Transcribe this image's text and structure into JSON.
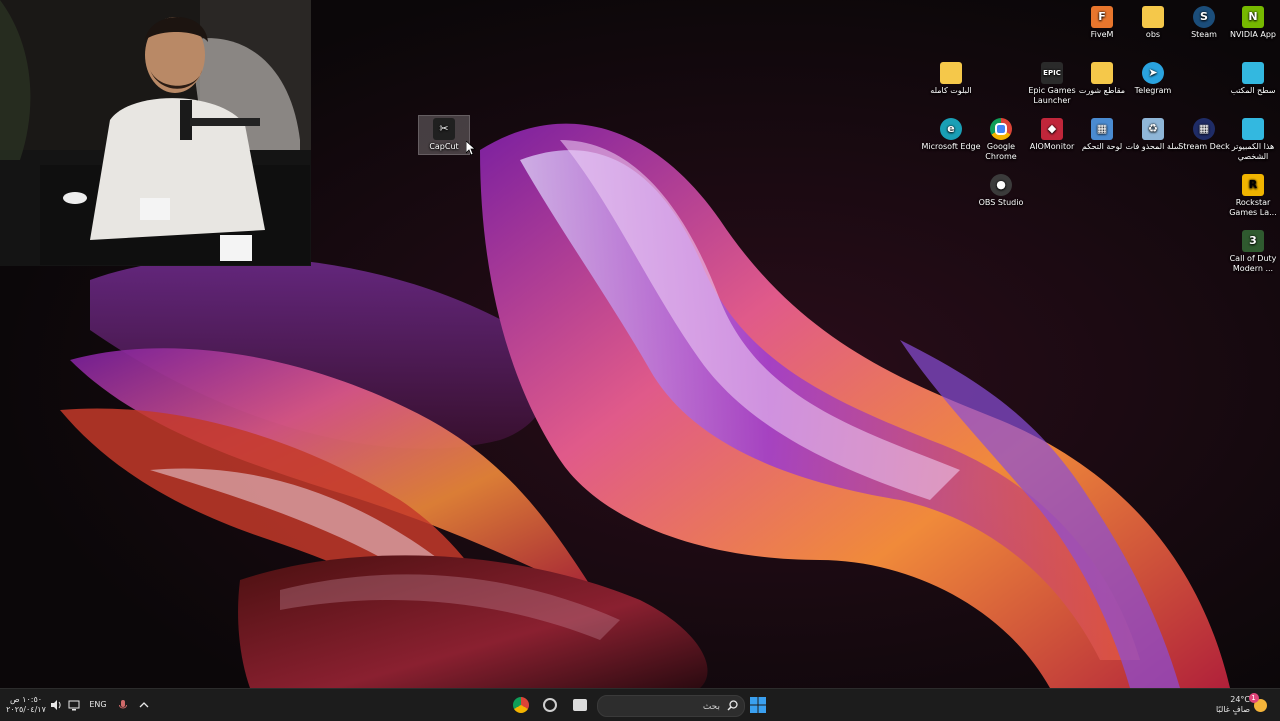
{
  "desktop": {
    "icons": [
      {
        "label": "FiveM",
        "icon": "fivem-icon",
        "color": "#e8762d"
      },
      {
        "label": "obs",
        "icon": "folder-icon",
        "color": "#f5c84a"
      },
      {
        "label": "Steam",
        "icon": "steam-icon",
        "color": "#1b4d7a"
      },
      {
        "label": "NVIDIA App",
        "icon": "nvidia-icon",
        "color": "#76b900"
      },
      {
        "label": "البلوت كامله",
        "icon": "folder-icon",
        "color": "#f5c84a"
      },
      {
        "label": "Epic Games Launcher",
        "icon": "epic-games-icon",
        "color": "#2a2a2a"
      },
      {
        "label": "مقاطع شورت",
        "icon": "folder-icon",
        "color": "#f5c84a"
      },
      {
        "label": "Telegram",
        "icon": "telegram-icon",
        "color": "#2aa3df"
      },
      {
        "label": "سطح المكتب",
        "icon": "desktop-monitor-icon",
        "color": "#33b8e0"
      },
      {
        "label": "Microsoft Edge",
        "icon": "edge-icon",
        "color": "#1a9fb5"
      },
      {
        "label": "Google Chrome",
        "icon": "chrome-icon",
        "color": "#db4437"
      },
      {
        "label": "AIOMonitor",
        "icon": "aiomonitor-icon",
        "color": "#c0263a"
      },
      {
        "label": "لوحة التحكم",
        "icon": "control-panel-icon",
        "color": "#4a8bd1"
      },
      {
        "label": "سلة المحذو فات",
        "icon": "recycle-bin-icon",
        "color": "#8fb6d8"
      },
      {
        "label": "Stream Deck",
        "icon": "stream-deck-icon",
        "color": "#1f2c66"
      },
      {
        "label": "هذا الكمبيوتر الشخصي",
        "icon": "this-pc-icon",
        "color": "#33b8e0"
      },
      {
        "label": "OBS Studio",
        "icon": "obs-icon",
        "color": "#3b3b3b"
      },
      {
        "label": "Rockstar Games La...",
        "icon": "rockstar-icon",
        "color": "#f0b400"
      },
      {
        "label": "Call of Duty Modern ...",
        "icon": "call-of-duty-icon",
        "color": "#2f5a2f"
      },
      {
        "label": "CapCut",
        "icon": "capcut-icon",
        "color": "#202020"
      }
    ]
  },
  "taskbar": {
    "search_placeholder": "بحث",
    "language": "ENG",
    "time": "١٠:٥٠ ص",
    "date": "٢٠٢٥/٠٤/١٧",
    "weather_temp": "24°C",
    "weather_desc": "صافٍ غالبًا",
    "notification_count": "1",
    "apps": [
      "windows-start-icon",
      "chrome-icon",
      "recorder-icon",
      "file-explorer-icon"
    ]
  },
  "colors": {
    "taskbar_bg": "#1c1c1c",
    "desktop_bg": "#0b0709",
    "accent": "#0078d4"
  }
}
